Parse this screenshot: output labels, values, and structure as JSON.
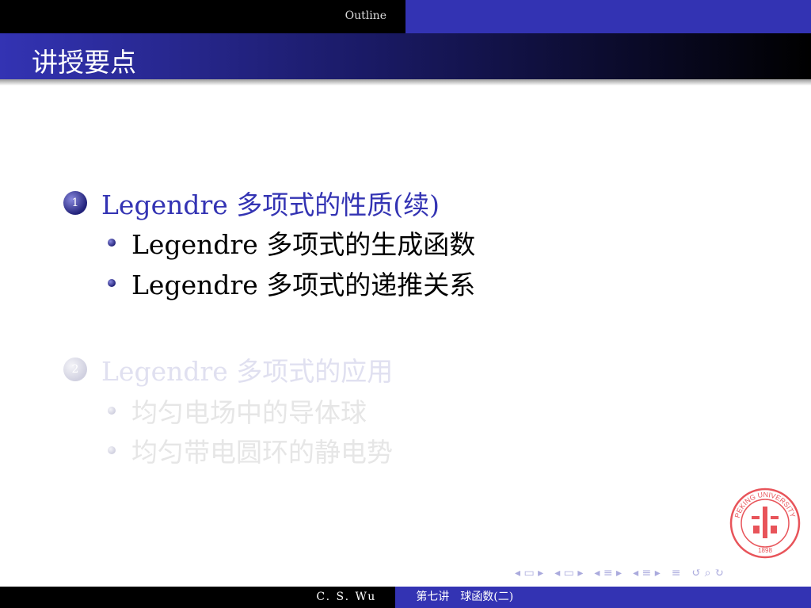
{
  "header": {
    "section": "Outline",
    "title": "讲授要点"
  },
  "outline": [
    {
      "number": "1",
      "label": "Legendre 多项式的性质(续)",
      "state": "active",
      "items": [
        "Legendre 多项式的生成函数",
        "Legendre 多项式的递推关系"
      ]
    },
    {
      "number": "2",
      "label": "Legendre 多项式的应用",
      "state": "dim",
      "items": [
        "均匀电场中的导体球",
        "均匀带电圆环的静电势"
      ]
    }
  ],
  "colors": {
    "accent": "#3333b3",
    "active_text": "#3333b3",
    "dim_text": "#e0e0ee",
    "item_text": "#000000",
    "logo": "#e8545a"
  },
  "logo": {
    "text": "PEKING UNIVERSITY",
    "year": "1898"
  },
  "nav_icons": [
    "frame-prev-icon",
    "frame-icon",
    "frame-next-icon",
    "slide-prev-icon",
    "slide-icon",
    "slide-next-icon",
    "section-prev-icon",
    "section-icon",
    "section-next-icon",
    "subsection-prev-icon",
    "subsection-icon",
    "subsection-next-icon",
    "toc-icon",
    "back-icon",
    "search-icon",
    "forward-icon"
  ],
  "footer": {
    "author": "C. S. Wu",
    "title": "第七讲　球函数(二)"
  }
}
